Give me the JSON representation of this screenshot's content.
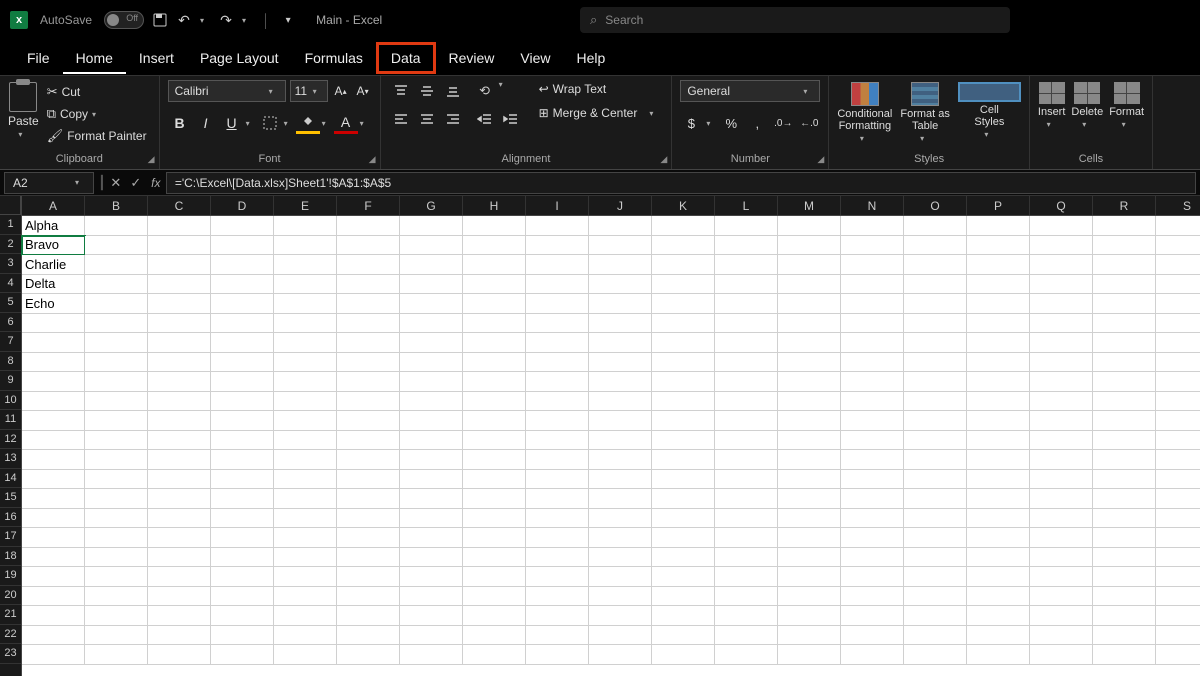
{
  "titlebar": {
    "autosave_label": "AutoSave",
    "autosave_state": "Off",
    "doc_title": "Main  -  Excel",
    "search_placeholder": "Search"
  },
  "tabs": {
    "file": "File",
    "home": "Home",
    "insert": "Insert",
    "page_layout": "Page Layout",
    "formulas": "Formulas",
    "data": "Data",
    "review": "Review",
    "view": "View",
    "help": "Help"
  },
  "ribbon": {
    "clipboard": {
      "label": "Clipboard",
      "paste": "Paste",
      "cut": "Cut",
      "copy": "Copy",
      "format_painter": "Format Painter"
    },
    "font": {
      "label": "Font",
      "name": "Calibri",
      "size": "11"
    },
    "alignment": {
      "label": "Alignment",
      "wrap": "Wrap Text",
      "merge": "Merge & Center"
    },
    "number": {
      "label": "Number",
      "format": "General"
    },
    "styles": {
      "label": "Styles",
      "conditional": "Conditional\nFormatting",
      "table": "Format as\nTable",
      "cell": "Cell\nStyles"
    },
    "cells": {
      "label": "Cells",
      "insert": "Insert",
      "delete": "Delete",
      "format": "Format"
    }
  },
  "formula_bar": {
    "name_box": "A2",
    "formula": "='C:\\Excel\\[Data.xlsx]Sheet1'!$A$1:$A$5"
  },
  "columns": [
    "A",
    "B",
    "C",
    "D",
    "E",
    "F",
    "G",
    "H",
    "I",
    "J",
    "K",
    "L",
    "M",
    "N",
    "O",
    "P",
    "Q",
    "R",
    "S"
  ],
  "rows": [
    "1",
    "2",
    "3",
    "4",
    "5",
    "6",
    "7",
    "8",
    "9",
    "10",
    "11",
    "12",
    "13",
    "14",
    "15",
    "16",
    "17",
    "18",
    "19",
    "20",
    "21",
    "22",
    "23"
  ],
  "cells": {
    "A1": "Alpha",
    "A2": "Bravo",
    "A3": "Charlie",
    "A4": "Delta",
    "A5": "Echo"
  },
  "selected_cell": "A2"
}
